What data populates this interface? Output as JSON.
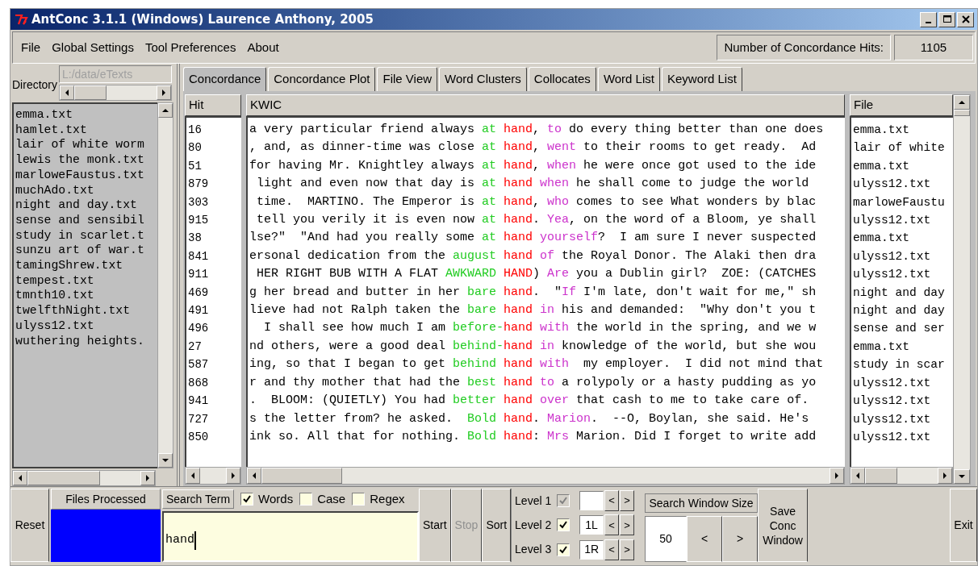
{
  "window": {
    "title": "AntConc 3.1.1 (Windows) Laurence Anthony, 2005"
  },
  "menu": [
    "File",
    "Global Settings",
    "Tool Preferences",
    "About"
  ],
  "hits": {
    "label": "Number of Concordance Hits:",
    "value": "1105"
  },
  "directory": {
    "label": "Directory",
    "value": "L:/data/eTexts",
    "disabled": true
  },
  "files": [
    "emma.txt",
    "hamlet.txt",
    "lair of white worm",
    "lewis the monk.txt",
    "marloweFaustus.txt",
    "muchAdo.txt",
    "night and day.txt",
    "sense and sensibil",
    "study in scarlet.t",
    "sunzu art of war.t",
    "tamingShrew.txt",
    "tempest.txt",
    "tmnth10.txt",
    "twelfthNight.txt",
    "ulyss12.txt",
    "wuthering heights."
  ],
  "tabs": [
    {
      "label": "Concordance",
      "selected": true
    },
    {
      "label": "Concordance Plot",
      "selected": false
    },
    {
      "label": "File View",
      "selected": false
    },
    {
      "label": "Word Clusters",
      "selected": false
    },
    {
      "label": "Collocates",
      "selected": false
    },
    {
      "label": "Word List",
      "selected": false
    },
    {
      "label": "Keyword List",
      "selected": false
    }
  ],
  "table": {
    "columns": [
      "Hit",
      "KWIC",
      "File"
    ],
    "rows": [
      {
        "hit": "16",
        "file": "emma.txt",
        "kwic": [
          {
            "text": "a very particular friend always ",
            "kind": "plain"
          },
          {
            "text": "at ",
            "kind": "left"
          },
          {
            "text": "hand",
            "kind": "key"
          },
          {
            "text": ", ",
            "kind": "plain"
          },
          {
            "text": "to",
            "kind": "right"
          },
          {
            "text": " do every thing better than one does",
            "kind": "plain"
          }
        ]
      },
      {
        "hit": "80",
        "file": "lair of white",
        "kwic": [
          {
            "text": ", and, as dinner-time was close ",
            "kind": "plain"
          },
          {
            "text": "at ",
            "kind": "left"
          },
          {
            "text": "hand",
            "kind": "key"
          },
          {
            "text": ", ",
            "kind": "plain"
          },
          {
            "text": "went",
            "kind": "right"
          },
          {
            "text": " to their rooms to get ready.  Ad",
            "kind": "plain"
          }
        ]
      },
      {
        "hit": "51",
        "file": "emma.txt",
        "kwic": [
          {
            "text": "for having Mr. Knightley always ",
            "kind": "plain"
          },
          {
            "text": "at ",
            "kind": "left"
          },
          {
            "text": "hand",
            "kind": "key"
          },
          {
            "text": ", ",
            "kind": "plain"
          },
          {
            "text": "when",
            "kind": "right"
          },
          {
            "text": " he were once got used to the ide",
            "kind": "plain"
          }
        ]
      },
      {
        "hit": "879",
        "file": "ulyss12.txt",
        "kwic": [
          {
            "text": " light and even now that day is ",
            "kind": "plain"
          },
          {
            "text": "at ",
            "kind": "left"
          },
          {
            "text": "hand",
            "kind": "key"
          },
          {
            "text": " when",
            "kind": "right"
          },
          {
            "text": " he shall come to judge the world",
            "kind": "plain"
          }
        ]
      },
      {
        "hit": "303",
        "file": "marloweFaustu",
        "kwic": [
          {
            "text": " time.  MARTINO. The Emperor is ",
            "kind": "plain"
          },
          {
            "text": "at ",
            "kind": "left"
          },
          {
            "text": "hand",
            "kind": "key"
          },
          {
            "text": ", ",
            "kind": "plain"
          },
          {
            "text": "who",
            "kind": "right"
          },
          {
            "text": " comes to see What wonders by blac",
            "kind": "plain"
          }
        ]
      },
      {
        "hit": "915",
        "file": "ulyss12.txt",
        "kwic": [
          {
            "text": " tell you verily it is even now ",
            "kind": "plain"
          },
          {
            "text": "at ",
            "kind": "left"
          },
          {
            "text": "hand",
            "kind": "key"
          },
          {
            "text": ". ",
            "kind": "plain"
          },
          {
            "text": "Yea",
            "kind": "right"
          },
          {
            "text": ", on the word of a Bloom, ye shall",
            "kind": "plain"
          }
        ]
      },
      {
        "hit": "38",
        "file": "emma.txt",
        "kwic": [
          {
            "text": "lse?\"  \"And had you really some ",
            "kind": "plain"
          },
          {
            "text": "at ",
            "kind": "left"
          },
          {
            "text": "hand",
            "kind": "key"
          },
          {
            "text": " yourself",
            "kind": "right"
          },
          {
            "text": "?  I am sure I never suspected",
            "kind": "plain"
          }
        ]
      },
      {
        "hit": "841",
        "file": "ulyss12.txt",
        "kwic": [
          {
            "text": "ersonal dedication from the ",
            "kind": "plain"
          },
          {
            "text": "august ",
            "kind": "left"
          },
          {
            "text": "hand",
            "kind": "key"
          },
          {
            "text": " of",
            "kind": "right"
          },
          {
            "text": " the Royal Donor. The Alaki then dra",
            "kind": "plain"
          }
        ]
      },
      {
        "hit": "911",
        "file": "ulyss12.txt",
        "kwic": [
          {
            "text": " HER RIGHT BUB WITH A FLAT ",
            "kind": "plain"
          },
          {
            "text": "AWKWARD ",
            "kind": "left"
          },
          {
            "text": "HAND",
            "kind": "key"
          },
          {
            "text": ") ",
            "kind": "plain"
          },
          {
            "text": "Are",
            "kind": "right"
          },
          {
            "text": " you a Dublin girl?  ZOE: (CATCHES",
            "kind": "plain"
          }
        ]
      },
      {
        "hit": "469",
        "file": "night and day",
        "kwic": [
          {
            "text": "g her bread and butter in her ",
            "kind": "plain"
          },
          {
            "text": "bare ",
            "kind": "left"
          },
          {
            "text": "hand",
            "kind": "key"
          },
          {
            "text": ".  \"",
            "kind": "plain"
          },
          {
            "text": "If",
            "kind": "right"
          },
          {
            "text": " I'm late, don't wait for me,\" sh",
            "kind": "plain"
          }
        ]
      },
      {
        "hit": "491",
        "file": "night and day",
        "kwic": [
          {
            "text": "lieve had not Ralph taken the ",
            "kind": "plain"
          },
          {
            "text": "bare ",
            "kind": "left"
          },
          {
            "text": "hand",
            "kind": "key"
          },
          {
            "text": " in",
            "kind": "right"
          },
          {
            "text": " his and demanded:  \"Why don't you t",
            "kind": "plain"
          }
        ]
      },
      {
        "hit": "496",
        "file": "sense and ser",
        "kwic": [
          {
            "text": "  I shall see how much I am ",
            "kind": "plain"
          },
          {
            "text": "before-",
            "kind": "left"
          },
          {
            "text": "hand",
            "kind": "key"
          },
          {
            "text": " with",
            "kind": "right"
          },
          {
            "text": " the world in the spring, and we w",
            "kind": "plain"
          }
        ]
      },
      {
        "hit": "27",
        "file": "emma.txt",
        "kwic": [
          {
            "text": "nd others, were a good deal ",
            "kind": "plain"
          },
          {
            "text": "behind-",
            "kind": "left"
          },
          {
            "text": "hand",
            "kind": "key"
          },
          {
            "text": " in",
            "kind": "right"
          },
          {
            "text": " knowledge of the world, but she wou",
            "kind": "plain"
          }
        ]
      },
      {
        "hit": "587",
        "file": "study in scar",
        "kwic": [
          {
            "text": "ing, so that I began to get ",
            "kind": "plain"
          },
          {
            "text": "behind ",
            "kind": "left"
          },
          {
            "text": "hand",
            "kind": "key"
          },
          {
            "text": " with",
            "kind": "right"
          },
          {
            "text": "  my employer.  I did not mind that",
            "kind": "plain"
          }
        ]
      },
      {
        "hit": "868",
        "file": "ulyss12.txt",
        "kwic": [
          {
            "text": "r and thy mother that had the ",
            "kind": "plain"
          },
          {
            "text": "best ",
            "kind": "left"
          },
          {
            "text": "hand",
            "kind": "key"
          },
          {
            "text": " to",
            "kind": "right"
          },
          {
            "text": " a rolypoly or a hasty pudding as yo",
            "kind": "plain"
          }
        ]
      },
      {
        "hit": "941",
        "file": "ulyss12.txt",
        "kwic": [
          {
            "text": ".  BLOOM: (QUIETLY) You had ",
            "kind": "plain"
          },
          {
            "text": "better ",
            "kind": "left"
          },
          {
            "text": "hand",
            "kind": "key"
          },
          {
            "text": " over",
            "kind": "right"
          },
          {
            "text": " that cash to me to take care of.",
            "kind": "plain"
          }
        ]
      },
      {
        "hit": "727",
        "file": "ulyss12.txt",
        "kwic": [
          {
            "text": "s the letter from? he asked.  ",
            "kind": "plain"
          },
          {
            "text": "Bold ",
            "kind": "left"
          },
          {
            "text": "hand",
            "kind": "key"
          },
          {
            "text": ". ",
            "kind": "plain"
          },
          {
            "text": "Marion",
            "kind": "right"
          },
          {
            "text": ".  --O, Boylan, she said. He's",
            "kind": "plain"
          }
        ]
      },
      {
        "hit": "850",
        "file": "ulyss12.txt",
        "kwic": [
          {
            "text": "ink so. All that for nothing. ",
            "kind": "plain"
          },
          {
            "text": "Bold ",
            "kind": "left"
          },
          {
            "text": "hand",
            "kind": "key"
          },
          {
            "text": ": ",
            "kind": "plain"
          },
          {
            "text": "Mrs",
            "kind": "right"
          },
          {
            "text": " Marion. Did I forget to write add",
            "kind": "plain"
          }
        ]
      }
    ]
  },
  "controls": {
    "reset": "Reset",
    "files_processed": {
      "label": "Files Processed",
      "level": 1
    },
    "search_term": {
      "label": "Search Term",
      "value": "hand"
    },
    "options": [
      {
        "label": "Words",
        "checked": true
      },
      {
        "label": "Case",
        "checked": false
      },
      {
        "label": "Regex",
        "checked": false
      }
    ],
    "actions": [
      {
        "label": "Start",
        "disabled": false
      },
      {
        "label": "Stop",
        "disabled": true
      },
      {
        "label": "Sort",
        "disabled": false
      }
    ],
    "levels": [
      {
        "label": "Level 1",
        "checked": true,
        "disabled": true
      },
      {
        "label": "Level 2",
        "checked": true,
        "disabled": false,
        "value": "1L"
      },
      {
        "label": "Level 3",
        "checked": true,
        "disabled": false,
        "value": "1R"
      }
    ],
    "search_window": {
      "label": "Search Window Size",
      "value": "50",
      "prev": "<",
      "next": ">"
    },
    "level_arrows": {
      "prev": "<",
      "next": ">"
    },
    "save": "Save Conc Window",
    "exit": "Exit"
  }
}
